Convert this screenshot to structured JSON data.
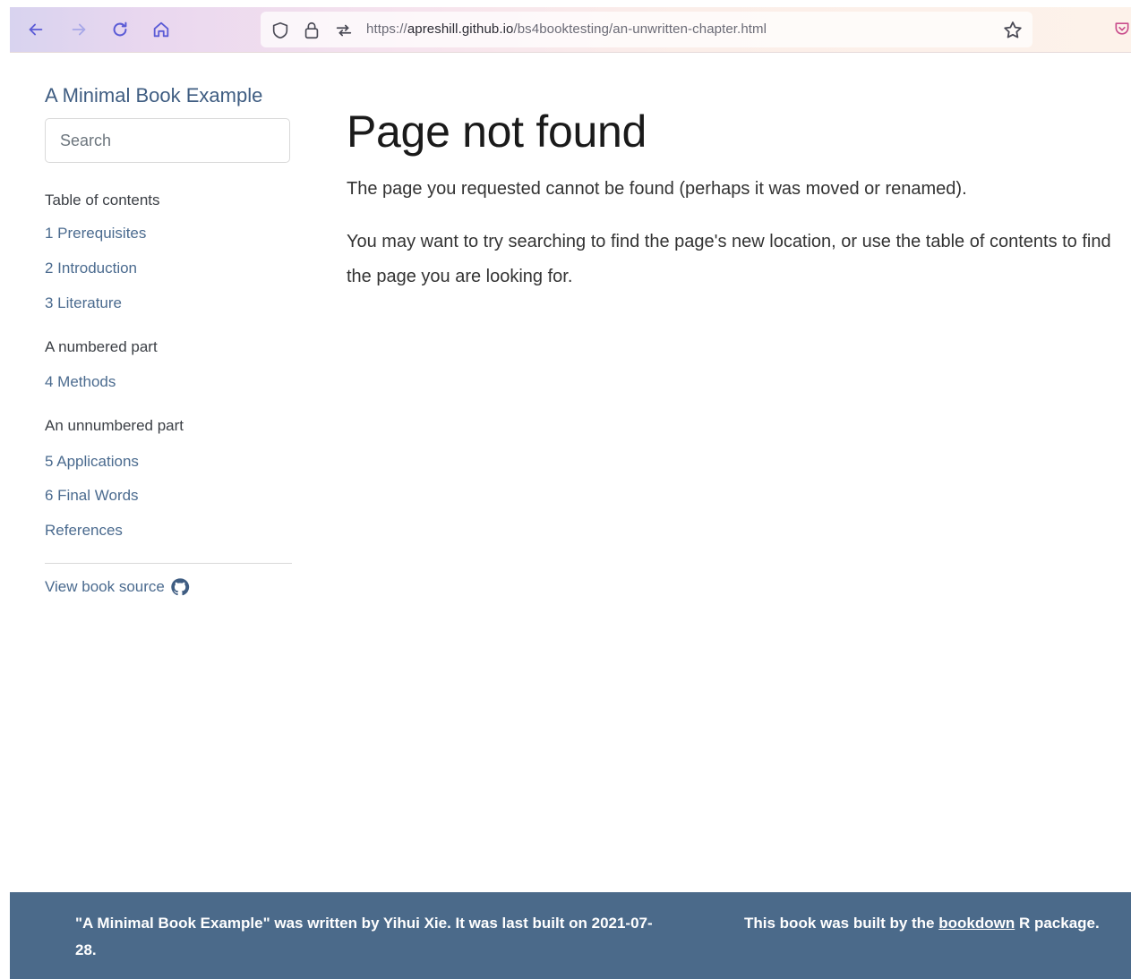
{
  "browser": {
    "url_prefix": "https://",
    "url_host": "apreshill.github.io",
    "url_path": "/bs4booktesting/an-unwritten-chapter.html",
    "icons": [
      "back-icon",
      "forward-icon",
      "reload-icon",
      "home-icon",
      "shield-icon",
      "lock-icon",
      "permissions-icon",
      "star-icon",
      "pocket-icon"
    ]
  },
  "sidebar": {
    "book_title": "A Minimal Book Example",
    "search_placeholder": "Search",
    "toc_heading": "Table of contents",
    "items": [
      {
        "type": "link",
        "label": "1 Prerequisites"
      },
      {
        "type": "link",
        "label": "2 Introduction"
      },
      {
        "type": "link",
        "label": "3 Literature"
      },
      {
        "type": "part",
        "label": "A numbered part"
      },
      {
        "type": "link",
        "label": "4 Methods"
      },
      {
        "type": "part",
        "label": "An unnumbered part"
      },
      {
        "type": "link",
        "label": "5 Applications"
      },
      {
        "type": "link",
        "label": "6 Final Words"
      },
      {
        "type": "link",
        "label": "References"
      }
    ],
    "source_label": "View book source"
  },
  "main": {
    "title": "Page not found",
    "paragraph1": "The page you requested cannot be found (perhaps it was moved or renamed).",
    "paragraph2": "You may want to try searching to find the page's new location, or use the table of contents to find the page you are looking for."
  },
  "footer": {
    "book_name": "\"A Minimal Book Example\"",
    "written_by": " was written by Yihui Xie. It was last built on 2021-07-28.",
    "built_prefix": "This book was built by the ",
    "bookdown_link": "bookdown",
    "built_suffix": " R package."
  },
  "colors": {
    "footer_bg": "#4b6a8a",
    "link": "#4b6b8f",
    "accent": "#5b5bd6"
  }
}
